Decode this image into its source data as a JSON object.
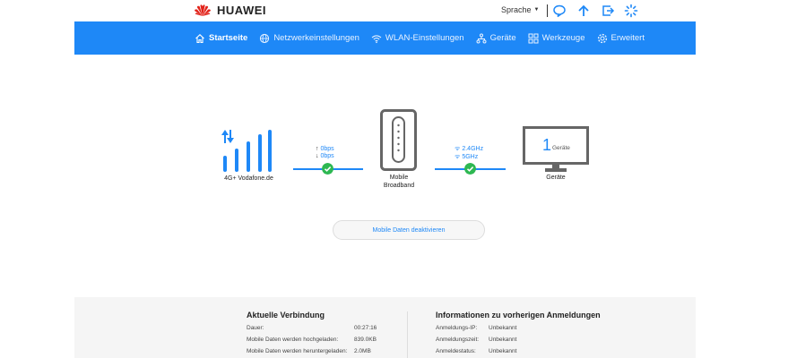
{
  "header": {
    "brand": "HUAWEI",
    "language_label": "Sprache",
    "icons": [
      "speech-bubble-icon",
      "upload-icon",
      "logout-icon",
      "loading-icon"
    ]
  },
  "nav": {
    "items": [
      {
        "label": "Startseite",
        "icon": "home-icon",
        "active": true
      },
      {
        "label": "Netzwerkeinstellungen",
        "icon": "globe-icon",
        "active": false
      },
      {
        "label": "WLAN-Einstellungen",
        "icon": "wifi-icon",
        "active": false
      },
      {
        "label": "Geräte",
        "icon": "devices-icon",
        "active": false
      },
      {
        "label": "Werkzeuge",
        "icon": "tools-icon",
        "active": false
      },
      {
        "label": "Erweitert",
        "icon": "gear-icon",
        "active": false
      }
    ]
  },
  "diagram": {
    "network_name": "4G+ Vodafone.de",
    "upload_rate": "0bps",
    "download_rate": "0bps",
    "router_label_line1": "Mobile",
    "router_label_line2": "Broadband",
    "band1": "2.4GHz",
    "band2": "5GHz",
    "device_count": "1",
    "device_count_unit": "Geräte",
    "devices_label": "Geräte"
  },
  "actions": {
    "deactivate_label": "Mobile Daten deaktivieren"
  },
  "connection": {
    "title": "Aktuelle Verbindung",
    "rows": [
      {
        "label": "Dauer:",
        "value": "00:27:16"
      },
      {
        "label": "Mobile Daten werden hochgeladen:",
        "value": "839.0KB"
      },
      {
        "label": "Mobile Daten werden heruntergeladen:",
        "value": "2.0MB"
      }
    ]
  },
  "login_info": {
    "title": "Informationen zu vorherigen Anmeldungen",
    "rows": [
      {
        "label": "Anmeldungs-IP:",
        "value": "Unbekannt"
      },
      {
        "label": "Anmeldungszeit:",
        "value": "Unbekannt"
      },
      {
        "label": "Anmeldestatus:",
        "value": "Unbekannt"
      }
    ]
  },
  "colors": {
    "accent": "#1e88f7",
    "success": "#2eb852",
    "brand_red": "#e2231a"
  }
}
